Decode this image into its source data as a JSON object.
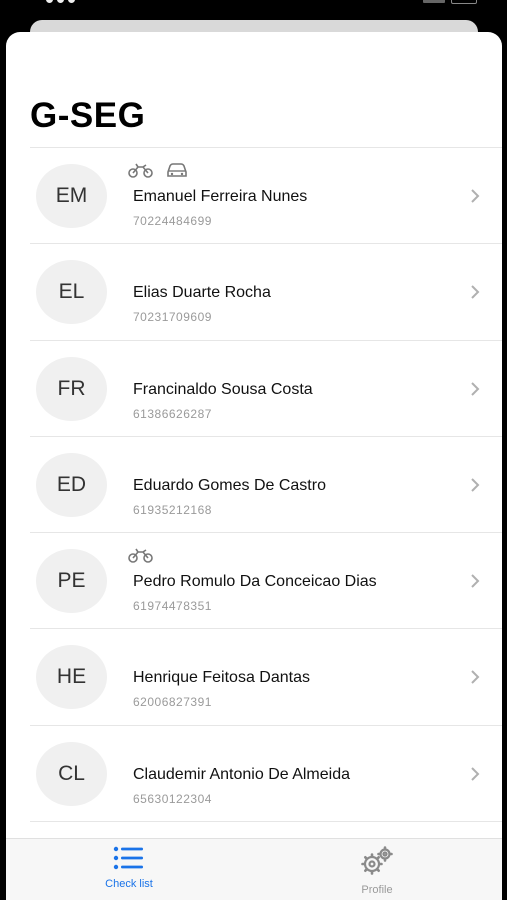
{
  "header": {
    "title": "G-SEG"
  },
  "people": [
    {
      "initials": "EM",
      "name": "Emanuel Ferreira Nunes",
      "doc": "70224484699",
      "vehicles": [
        "motorcycle-icon",
        "car-icon"
      ]
    },
    {
      "initials": "EL",
      "name": "Elias Duarte Rocha",
      "doc": "70231709609",
      "vehicles": []
    },
    {
      "initials": "FR",
      "name": "Francinaldo Sousa Costa",
      "doc": "61386626287",
      "vehicles": []
    },
    {
      "initials": "ED",
      "name": "Eduardo Gomes De Castro",
      "doc": "61935212168",
      "vehicles": []
    },
    {
      "initials": "PE",
      "name": "Pedro Romulo Da Conceicao Dias",
      "doc": "61974478351",
      "vehicles": [
        "motorcycle-icon"
      ]
    },
    {
      "initials": "HE",
      "name": "Henrique Feitosa Dantas",
      "doc": "62006827391",
      "vehicles": []
    },
    {
      "initials": "CL",
      "name": "Claudemir Antonio De Almeida",
      "doc": "65630122304",
      "vehicles": []
    }
  ],
  "tabs": [
    {
      "label": "Check list",
      "icon": "list-icon",
      "active": true
    },
    {
      "label": "Profile",
      "icon": "gears-icon",
      "active": false
    }
  ],
  "colors": {
    "accent": "#1a73e8",
    "muted": "#9a9a9a",
    "avatar_bg": "#f0f0f0"
  }
}
